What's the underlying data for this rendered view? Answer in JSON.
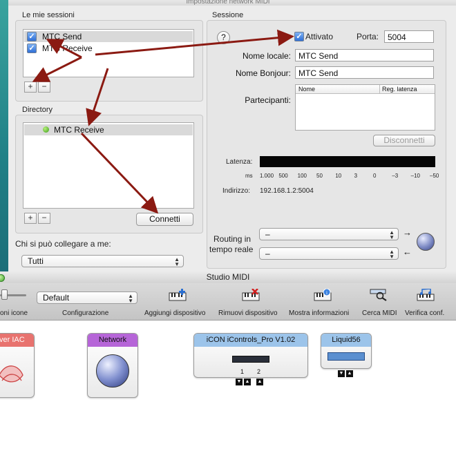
{
  "top_window": {
    "title": "Impostazione network MIDI",
    "my_sessions": {
      "title": "Le mie sessioni",
      "items": [
        {
          "label": "MTC Send",
          "checked": true,
          "selected": true
        },
        {
          "label": "MTC Receive",
          "checked": true,
          "selected": false
        }
      ],
      "add_label": "+",
      "remove_label": "−"
    },
    "directory": {
      "title": "Directory",
      "items": [
        {
          "label": "MTC Receive",
          "status": "online"
        }
      ],
      "add_label": "+",
      "remove_label": "−",
      "connect_label": "Connetti"
    },
    "who_can_connect": {
      "label": "Chi si può collegare a me:",
      "value": "Tutti"
    },
    "session": {
      "title": "Sessione",
      "help_label": "?",
      "enabled_label": "Attivato",
      "enabled": true,
      "port_label": "Porta:",
      "port_value": "5004",
      "local_name_label": "Nome locale:",
      "local_name_value": "MTC Send",
      "bonjour_name_label": "Nome Bonjour:",
      "bonjour_name_value": "MTC Send",
      "participants_label": "Partecipanti:",
      "participants_columns": [
        "Nome",
        "Reg. latenza"
      ],
      "disconnect_label": "Disconnetti",
      "latency_label": "Latenza:",
      "latency_ticks": [
        "1.000",
        "500",
        "100",
        "50",
        "10",
        "3",
        "0",
        "–3",
        "–10",
        "–50"
      ],
      "latency_unit": "ms",
      "address_label": "Indirizzo:",
      "address_value": "192.168.1.2:5004",
      "routing_label_line1": "Routing in",
      "routing_label_line2": "tempo reale",
      "routing_out_value": "–",
      "routing_in_value": "–"
    }
  },
  "studio_window": {
    "title": "Studio MIDI",
    "toolbar": {
      "icon_size_label": "oni icone",
      "configuration_value": "Default",
      "configuration_label": "Configurazione",
      "add_device_label": "Aggiungi dispositivo",
      "remove_device_label": "Rimuovi dispositivo",
      "show_info_label": "Mostra informazioni",
      "search_midi_label": "Cerca MIDI",
      "verify_config_label": "Verifica conf."
    },
    "devices": [
      {
        "name": "ver IAC",
        "color": "#e8736f"
      },
      {
        "name": "Network",
        "color": "#b665d8"
      },
      {
        "name": "iCON iControls_Pro V1.02",
        "color": "#9cc4ea",
        "ports": [
          "1",
          "2"
        ]
      },
      {
        "name": "Liquid56",
        "color": "#9cc4ea"
      }
    ]
  },
  "colors": {
    "annotation_arrow": "#8b1a12",
    "selection": "#d9d9d9",
    "checkbox": "#3a7be0"
  }
}
